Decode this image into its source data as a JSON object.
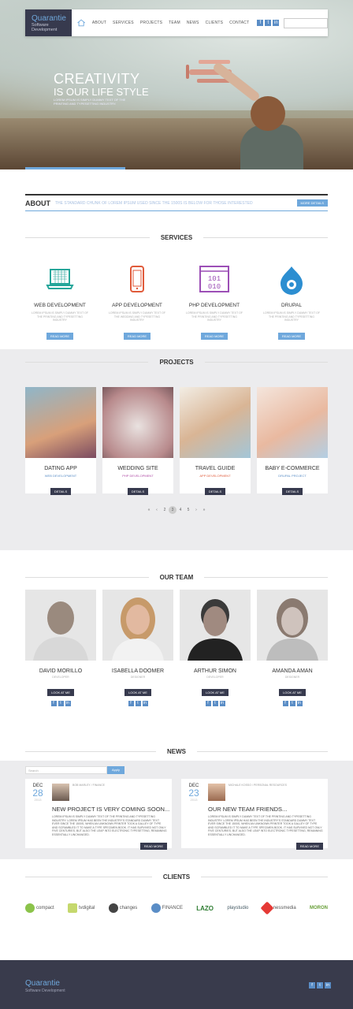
{
  "brand": {
    "name": "Quarantie",
    "tagline": "Software Development"
  },
  "nav": {
    "items": [
      "ABOUT",
      "SERVICES",
      "PROJECTS",
      "TEAM",
      "NEWS",
      "CLIENTS",
      "CONTACT"
    ],
    "social": [
      "f",
      "t",
      "in"
    ]
  },
  "hero": {
    "title": "CREATIVITY",
    "subtitle": "IS OUR LIFE STYLE",
    "text": "LOREM IPSUM IS SIMPLY DUMMY TEXT OF THE PRINTING AND TYPESETTING INDUSTRY."
  },
  "about": {
    "title": "ABOUT",
    "text": "THE STANDARD CHUNK OF LOREM IPSUM USED SINCE THE 1500S IS BELOW FOR THOSE INTERESTED",
    "button": "MORE DETAILS"
  },
  "services": {
    "title": "SERVICES",
    "items": [
      {
        "name": "WEB DEVELOPMENT",
        "icon": "laptop-icon",
        "text": "LOREM IPSUM IS SIMPLY DUMMY TEXT OF THE PRINTING AND TYPESETTING INDUSTRY",
        "button": "READ MORE"
      },
      {
        "name": "APP DEVELOPMENT",
        "icon": "phone-icon",
        "text": "LOREM IPSUM IS SIMPLY DUMMY TEXT OF THE WEDDING AND TYPESETTING INDUSTRY",
        "button": "READ MORE"
      },
      {
        "name": "PHP DEVELOPMENT",
        "icon": "binary-icon",
        "text": "LOREM IPSUM IS SIMPLY DUMMY TEXT OF THE PRINTING AND TYPESETTING INDUSTRY",
        "button": "READ MORE"
      },
      {
        "name": "DRUPAL",
        "icon": "drupal-icon",
        "text": "LOREM IPSUM IS SIMPLY DUMMY TEXT OF THE PRINTING AND TYPESETTING INDUSTRY",
        "button": "READ MORE"
      }
    ]
  },
  "projects": {
    "title": "PROJECTS",
    "items": [
      {
        "name": "DATING APP",
        "category": "WEB DEVELOPMENT",
        "button": "DETAILS",
        "cat_color": "#5a8dc6"
      },
      {
        "name": "WEDDING SITE",
        "category": "PHP DEVELOPMENT",
        "button": "DETAILS",
        "cat_color": "#b04ba6"
      },
      {
        "name": "TRAVEL GUIDE",
        "category": "APP DEVELOPMENT",
        "button": "DETAILS",
        "cat_color": "#e05a3a"
      },
      {
        "name": "BABY E-COMMERCE",
        "category": "DRUPAL PROJECT",
        "button": "DETAILS",
        "cat_color": "#5a8dc6"
      }
    ],
    "pager": [
      "«",
      "‹",
      "2",
      "3",
      "4",
      "5",
      "›",
      "»"
    ],
    "pager_active": "3"
  },
  "team": {
    "title": "OUR TEAM",
    "members": [
      {
        "name": "DAVID MORILLO",
        "role": "DEVELOPER",
        "button": "LOOK AT ME"
      },
      {
        "name": "ISABELLA DOOMER",
        "role": "DESIGNER",
        "button": "LOOK AT ME"
      },
      {
        "name": "ARTHUR SIMON",
        "role": "DEVELOPER",
        "button": "LOOK AT ME"
      },
      {
        "name": "AMANDA AMAN",
        "role": "DESIGNER",
        "button": "LOOK AT ME"
      }
    ]
  },
  "news": {
    "title": "NEWS",
    "search_placeholder": "Search",
    "apply": "Apply",
    "items": [
      {
        "month": "DEC",
        "day": "28",
        "year": "2013",
        "author": "BOB MARLEY / FINANCE",
        "headline": "NEW PROJECT IS VERY COMING SOON...",
        "text": "LOREM IPSUM IS SIMPLY DUMMY TEXT OF THE PRINTING AND TYPESETTING INDUSTRY. LOREM IPSUM HAS BEEN THE INDUSTRY'S STANDARD DUMMY TEXT EVER SINCE THE 1500S, WHEN AN UNKNOWN PRINTER TOOK A GALLEY OF TYPE AND SCRAMBLED IT TO MAKE A TYPE SPECIMEN BOOK. IT HAS SURVIVED NOT ONLY FIVE CENTURIES, BUT ALSO THE LEAP INTO ELECTRONIC TYPESETTING, REMAINING ESSENTIALLY UNCHANGED.",
        "button": "READ MORE"
      },
      {
        "month": "DEC",
        "day": "23",
        "year": "2013",
        "author": "MICHALE KOSSO / PERSONAL RESOURCES",
        "headline": "OUR NEW TEAM FRIENDS...",
        "text": "LOREM IPSUM IS SIMPLY DUMMY TEXT OF THE PRINTING AND TYPESETTING INDUSTRY. LOREM IPSUM HAS BEEN THE INDUSTRY'S STANDARD DUMMY TEXT EVER SINCE THE 1500S, WHEN AN UNKNOWN PRINTER TOOK A GALLEY OF TYPE AND SCRAMBLED IT TO MAKE A TYPE SPECIMEN BOOK. IT HAS SURVIVED NOT ONLY FIVE CENTURIES, BUT ALSO THE LEAP INTO ELECTRONIC TYPESETTING, REMAINING ESSENTIALLY UNCHANGED.",
        "button": "READ MORE"
      }
    ]
  },
  "clients": {
    "title": "CLIENTS",
    "items": [
      {
        "name": "compact",
        "color": "#8bc34a"
      },
      {
        "name": "tvdigital",
        "color": "#c5d86d"
      },
      {
        "name": "changes",
        "color": "#444"
      },
      {
        "name": "FINANCE",
        "color": "#5a8dc6"
      },
      {
        "name": "LAZO",
        "color": "#2e7d32"
      },
      {
        "name": "playstudio",
        "color": "#455a64"
      },
      {
        "name": "nessmedia",
        "color": "#e53935"
      },
      {
        "name": "MORON",
        "color": "#689f38"
      }
    ]
  },
  "footer": {
    "name": "Quarantie",
    "tagline": "Software Development",
    "social": [
      "f",
      "t",
      "in"
    ]
  }
}
